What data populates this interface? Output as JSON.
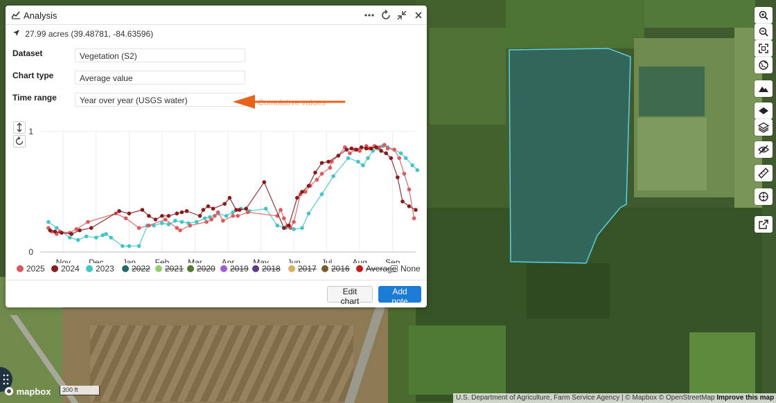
{
  "panel": {
    "title": "Analysis",
    "location": "27.99 acres (39.48781, -84.63596)",
    "dataset_label": "Dataset",
    "dataset_value": "Vegetation (S2)",
    "chart_type_label": "Chart type",
    "chart_type_value": "Average value",
    "time_range_label": "Time range",
    "time_range_value": "Year over year (USGS water)",
    "annotation_text": "Cumulative values",
    "edit_chart_label": "Edit chart",
    "add_note_label": "Add note"
  },
  "legend": [
    {
      "name": "2025",
      "color": "#e0585b",
      "active": true
    },
    {
      "name": "2024",
      "color": "#8b1a1a",
      "active": true
    },
    {
      "name": "2023",
      "color": "#3fc7c7",
      "active": true
    },
    {
      "name": "2022",
      "color": "#1f6b6b",
      "active": false
    },
    {
      "name": "2021",
      "color": "#8fd16b",
      "active": false
    },
    {
      "name": "2020",
      "color": "#4f7a30",
      "active": false
    },
    {
      "name": "2019",
      "color": "#a05cd6",
      "active": false
    },
    {
      "name": "2018",
      "color": "#5a3a8a",
      "active": false
    },
    {
      "name": "2017",
      "color": "#d8b060",
      "active": false
    },
    {
      "name": "2016",
      "color": "#7a5a2a",
      "active": false
    },
    {
      "name": "Average",
      "color": "#c81818",
      "active": false
    },
    {
      "name": "None",
      "color": "",
      "active": true
    }
  ],
  "chart_data": {
    "type": "line",
    "x_unit": "month",
    "categories": [
      "Nov",
      "Dec",
      "Jan",
      "Feb",
      "Mar",
      "Apr",
      "May",
      "Jun",
      "Jul",
      "Aug",
      "Sep"
    ],
    "ylim": [
      0,
      1
    ],
    "yticks": [
      "1",
      "0"
    ],
    "grid": true,
    "series": [
      {
        "name": "2025",
        "color": "#e0585b",
        "x": [
          -0.45,
          -0.35,
          -0.2,
          -0.1,
          0.2,
          0.4,
          0.75,
          1.6,
          1.9,
          2.3,
          2.6,
          3.1,
          3.45,
          3.55,
          3.85,
          4.35,
          4.5,
          4.6,
          4.7,
          4.85,
          5.15,
          5.3,
          5.6,
          6.5,
          6.6,
          6.7,
          6.8,
          6.9,
          7.0,
          7.2,
          7.35,
          7.5,
          7.7,
          7.85,
          8.1,
          8.15,
          8.35,
          8.55,
          8.7,
          8.85,
          9.0,
          9.2,
          9.3,
          9.45,
          9.6,
          9.75,
          9.85,
          10.05,
          10.2,
          10.35,
          10.5,
          10.65
        ],
        "y": [
          0.2,
          0.17,
          0.15,
          0.17,
          0.16,
          0.19,
          0.25,
          0.32,
          0.28,
          0.2,
          0.22,
          0.27,
          0.2,
          0.18,
          0.22,
          0.25,
          0.27,
          0.3,
          0.33,
          0.26,
          0.3,
          0.3,
          0.33,
          0.3,
          0.35,
          0.28,
          0.22,
          0.2,
          0.25,
          0.48,
          0.5,
          0.55,
          0.6,
          0.65,
          0.7,
          0.75,
          0.8,
          0.87,
          0.82,
          0.85,
          0.84,
          0.88,
          0.86,
          0.88,
          0.87,
          0.89,
          0.86,
          0.85,
          0.78,
          0.65,
          0.52,
          0.28
        ]
      },
      {
        "name": "2024",
        "color": "#8b1a1a",
        "x": [
          -0.4,
          -0.25,
          -0.05,
          0.25,
          0.5,
          0.85,
          1.7,
          2.0,
          2.4,
          2.6,
          2.8,
          3.0,
          3.2,
          3.45,
          3.6,
          3.75,
          4.15,
          4.25,
          4.4,
          4.55,
          4.9,
          5.05,
          5.25,
          5.35,
          5.55,
          6.1,
          6.7,
          6.85,
          7.1,
          7.25,
          7.45,
          7.65,
          7.85,
          8.05,
          8.35,
          8.6,
          8.75,
          8.9,
          9.05,
          9.2,
          9.35,
          9.5,
          9.65,
          9.8,
          9.95,
          10.15,
          10.3,
          10.5,
          10.7
        ],
        "y": [
          0.18,
          0.17,
          0.16,
          0.15,
          0.18,
          0.2,
          0.34,
          0.32,
          0.35,
          0.3,
          0.27,
          0.3,
          0.3,
          0.32,
          0.33,
          0.34,
          0.3,
          0.35,
          0.38,
          0.36,
          0.4,
          0.45,
          0.35,
          0.35,
          0.36,
          0.58,
          0.2,
          0.22,
          0.45,
          0.5,
          0.55,
          0.66,
          0.74,
          0.75,
          0.8,
          0.85,
          0.86,
          0.85,
          0.87,
          0.86,
          0.86,
          0.87,
          0.84,
          0.82,
          0.78,
          0.62,
          0.42,
          0.38,
          0.35
        ]
      },
      {
        "name": "2023",
        "color": "#3fc7c7",
        "x": [
          -0.45,
          -0.2,
          0.2,
          0.45,
          0.7,
          1.0,
          1.2,
          1.3,
          1.45,
          1.8,
          2.0,
          2.3,
          2.55,
          2.75,
          3.0,
          3.2,
          3.4,
          3.6,
          3.8,
          4.05,
          4.3,
          4.45,
          4.7,
          4.95,
          5.15,
          5.4,
          5.65,
          6.15,
          6.5,
          6.75,
          7.0,
          7.25,
          7.45,
          7.85,
          8.2,
          8.65,
          8.95,
          9.1,
          9.25,
          9.4,
          9.55,
          9.7,
          9.85,
          10.05,
          10.25,
          10.4,
          10.6,
          10.75
        ],
        "y": [
          0.25,
          0.2,
          0.12,
          0.1,
          0.13,
          0.12,
          0.14,
          0.15,
          0.12,
          0.05,
          0.05,
          0.05,
          0.22,
          0.22,
          0.24,
          0.23,
          0.26,
          0.25,
          0.24,
          0.25,
          0.28,
          0.29,
          0.32,
          0.3,
          0.33,
          0.36,
          0.34,
          0.36,
          0.22,
          0.2,
          0.19,
          0.2,
          0.32,
          0.48,
          0.63,
          0.78,
          0.75,
          0.72,
          0.78,
          0.84,
          0.86,
          0.88,
          0.87,
          0.85,
          0.82,
          0.78,
          0.72,
          0.68
        ]
      }
    ]
  },
  "attribution": {
    "text": "U.S. Department of Agriculture, Farm Service Agency | © Mapbox © OpenStreetMap",
    "link": "Improve this map"
  },
  "mapbox_logo": "mapbox",
  "scale_label": "300 ft"
}
